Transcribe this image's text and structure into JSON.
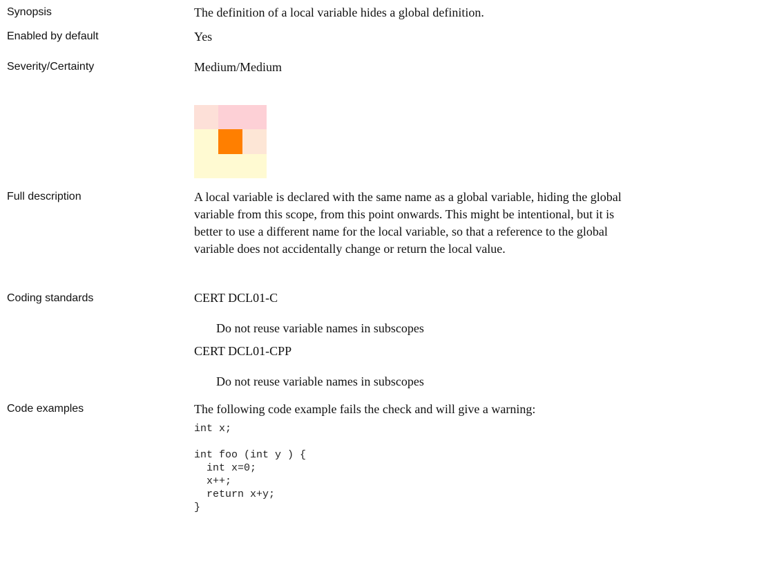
{
  "labels": {
    "synopsis": "Synopsis",
    "enabled": "Enabled by default",
    "severity": "Severity/Certainty",
    "full_description": "Full description",
    "coding_standards": "Coding standards",
    "code_examples": "Code examples"
  },
  "values": {
    "synopsis": "The definition of a local variable hides a global definition.",
    "enabled": "Yes",
    "severity": "Medium/Medium",
    "full_description_lines": [
      "A local variable is declared with the same name as a global variable, hiding the global",
      "variable from this scope, from this point onwards.  This might be intentional, but it is",
      "better to use a different name for the local variable, so that a reference to the global",
      "variable does not accidentally change or return the local value."
    ],
    "coding_standards": [
      {
        "name": "CERT DCL01-C",
        "description": "Do not reuse variable names in subscopes"
      },
      {
        "name": "CERT DCL01-CPP",
        "description": "Do not reuse variable names in subscopes"
      }
    ],
    "code_intro": "The following code example fails the check and will give a warning:",
    "code_lines": [
      "int x;",
      "",
      "int foo (int y ) {",
      "  int x=0;",
      "  x++;",
      "  return x+y;",
      "}"
    ]
  },
  "severity_matrix": {
    "cells": [
      "#fde0d8",
      "#fdd0d6",
      "#fdd0d6",
      "#fffad2",
      "#ff7f00",
      "#fde6d6",
      "#fffad2",
      "#fffad2",
      "#fffad2"
    ]
  }
}
